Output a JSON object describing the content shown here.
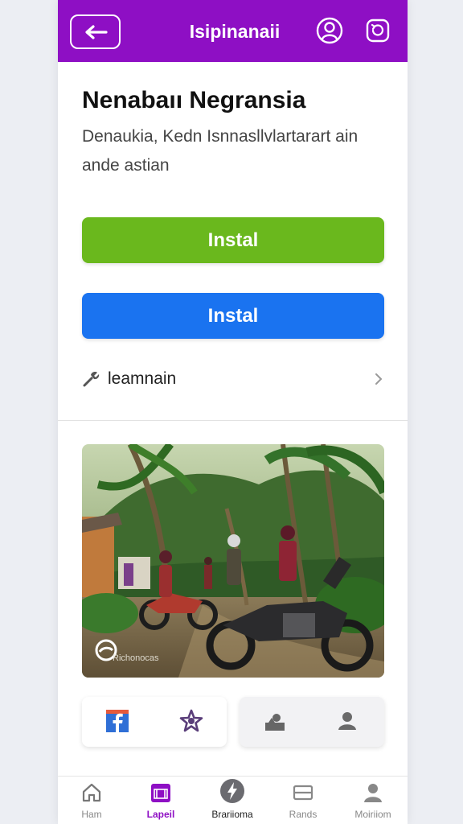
{
  "header": {
    "title": "Isipinanaii",
    "back_icon": "arrow-left-icon",
    "profile_icon": "user-profile-icon",
    "refresh_icon": "refresh-icon",
    "background": "#8e0fc4"
  },
  "main": {
    "title": "Nenabaıı Negransia",
    "description": "Denaukia, Kedn Isnnasllvlartarart ain ande astian",
    "primary_button": {
      "label": "Instal",
      "color": "#6ab81d"
    },
    "secondary_button": {
      "label": "Instal",
      "color": "#1a73f0"
    },
    "list_row": {
      "label": "leamnain",
      "icon": "wrench-icon",
      "trailing_icon": "chevron-right-icon"
    },
    "photo": {
      "alt_icon": "photo-image",
      "caption": "Richonocas"
    },
    "share_left": {
      "icons": [
        "facebook-icon",
        "star-badge-icon"
      ]
    },
    "share_right": {
      "icons": [
        "upload-person-icon",
        "person-icon"
      ]
    }
  },
  "bottom_nav": {
    "items": [
      {
        "label": "Ham",
        "icon": "home-icon",
        "active": false
      },
      {
        "label": "Lapeil",
        "icon": "calendar-icon",
        "active": true
      },
      {
        "label": "Brariioma",
        "icon": "lightning-icon",
        "active": false
      },
      {
        "label": "Rands",
        "icon": "card-icon",
        "active": false
      },
      {
        "label": "Moiriiom",
        "icon": "person-icon",
        "active": false
      }
    ],
    "accent": "#8e0fc4"
  }
}
